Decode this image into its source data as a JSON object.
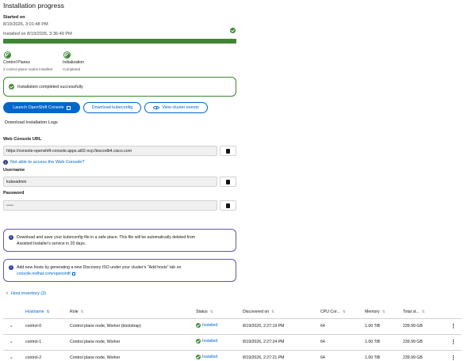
{
  "page_title": "Installation progress",
  "started": {
    "label": "Started on",
    "value": "8/19/2026, 3:01:48 PM"
  },
  "installed": {
    "text": "Installed on 8/19/2026, 3:36:49 PM"
  },
  "progress": {
    "percent": 100,
    "color": "#3e8635"
  },
  "steps": [
    {
      "title": "Control Planes",
      "subtitle": "3 control plane nodes installed"
    },
    {
      "title": "Initialization",
      "subtitle": "Completed"
    }
  ],
  "success_alert": {
    "text": "Installation completed successfully"
  },
  "buttons": {
    "launch": "Launch OpenShift Console",
    "download_kubeconfig": "Download kubeconfig",
    "view_events": "View cluster events",
    "download_logs": "Download Installation Logs"
  },
  "web_console": {
    "label": "Web Console URL",
    "value": "https://console-openshift-console.apps.ai02-ocp.fiescodb4.cisco.com",
    "help_link": "Not able to access the Web Console?"
  },
  "username": {
    "label": "Username",
    "value": "kubeadmin"
  },
  "password": {
    "label": "Password",
    "value": "•••••"
  },
  "alerts": {
    "kubeconfig_line1": "Download and save your kubeconfig file in a safe place. This file will be automatically deleted from",
    "kubeconfig_line2": "Assisted Installer's service in 20 days.",
    "hosts_line1": "Add new hosts by generating a new Discovery ISO under your cluster's \"Add hosts\" tab on",
    "hosts_link": "console.redhat.com/openshift"
  },
  "host_inventory": {
    "label": "Host inventory (3)"
  },
  "table": {
    "columns": [
      "Hostname",
      "Role",
      "Status",
      "Discovered on",
      "CPU Cor...",
      "Memory",
      "Total st..."
    ],
    "rows": [
      {
        "hostname": "control-0",
        "role": "Control plane node, Worker (bootstrap)",
        "status": "Installed",
        "discovered": "8/19/2026, 2:27:19 PM",
        "cpu": "64",
        "memory": "1.00 TiB",
        "storage": "239.99 GB"
      },
      {
        "hostname": "control-1",
        "role": "Control plane node, Worker",
        "status": "Installed",
        "discovered": "8/19/2026, 2:27:24 PM",
        "cpu": "64",
        "memory": "1.00 TiB",
        "storage": "239.99 GB"
      },
      {
        "hostname": "control-2",
        "role": "Control plane node, Worker",
        "status": "Installed",
        "discovered": "8/19/2026, 2:27:21 PM",
        "cpu": "64",
        "memory": "1.00 TiB",
        "storage": "239.99 GB"
      }
    ]
  },
  "icons": [
    "check-circle-icon",
    "external-link-icon",
    "eye-icon",
    "copy-icon",
    "info-icon",
    "sort-icon",
    "caret-icon",
    "kebab-icon"
  ],
  "colors": {
    "success": "#3e8635",
    "primary": "#0066cc",
    "info_border": "#6753ac"
  }
}
